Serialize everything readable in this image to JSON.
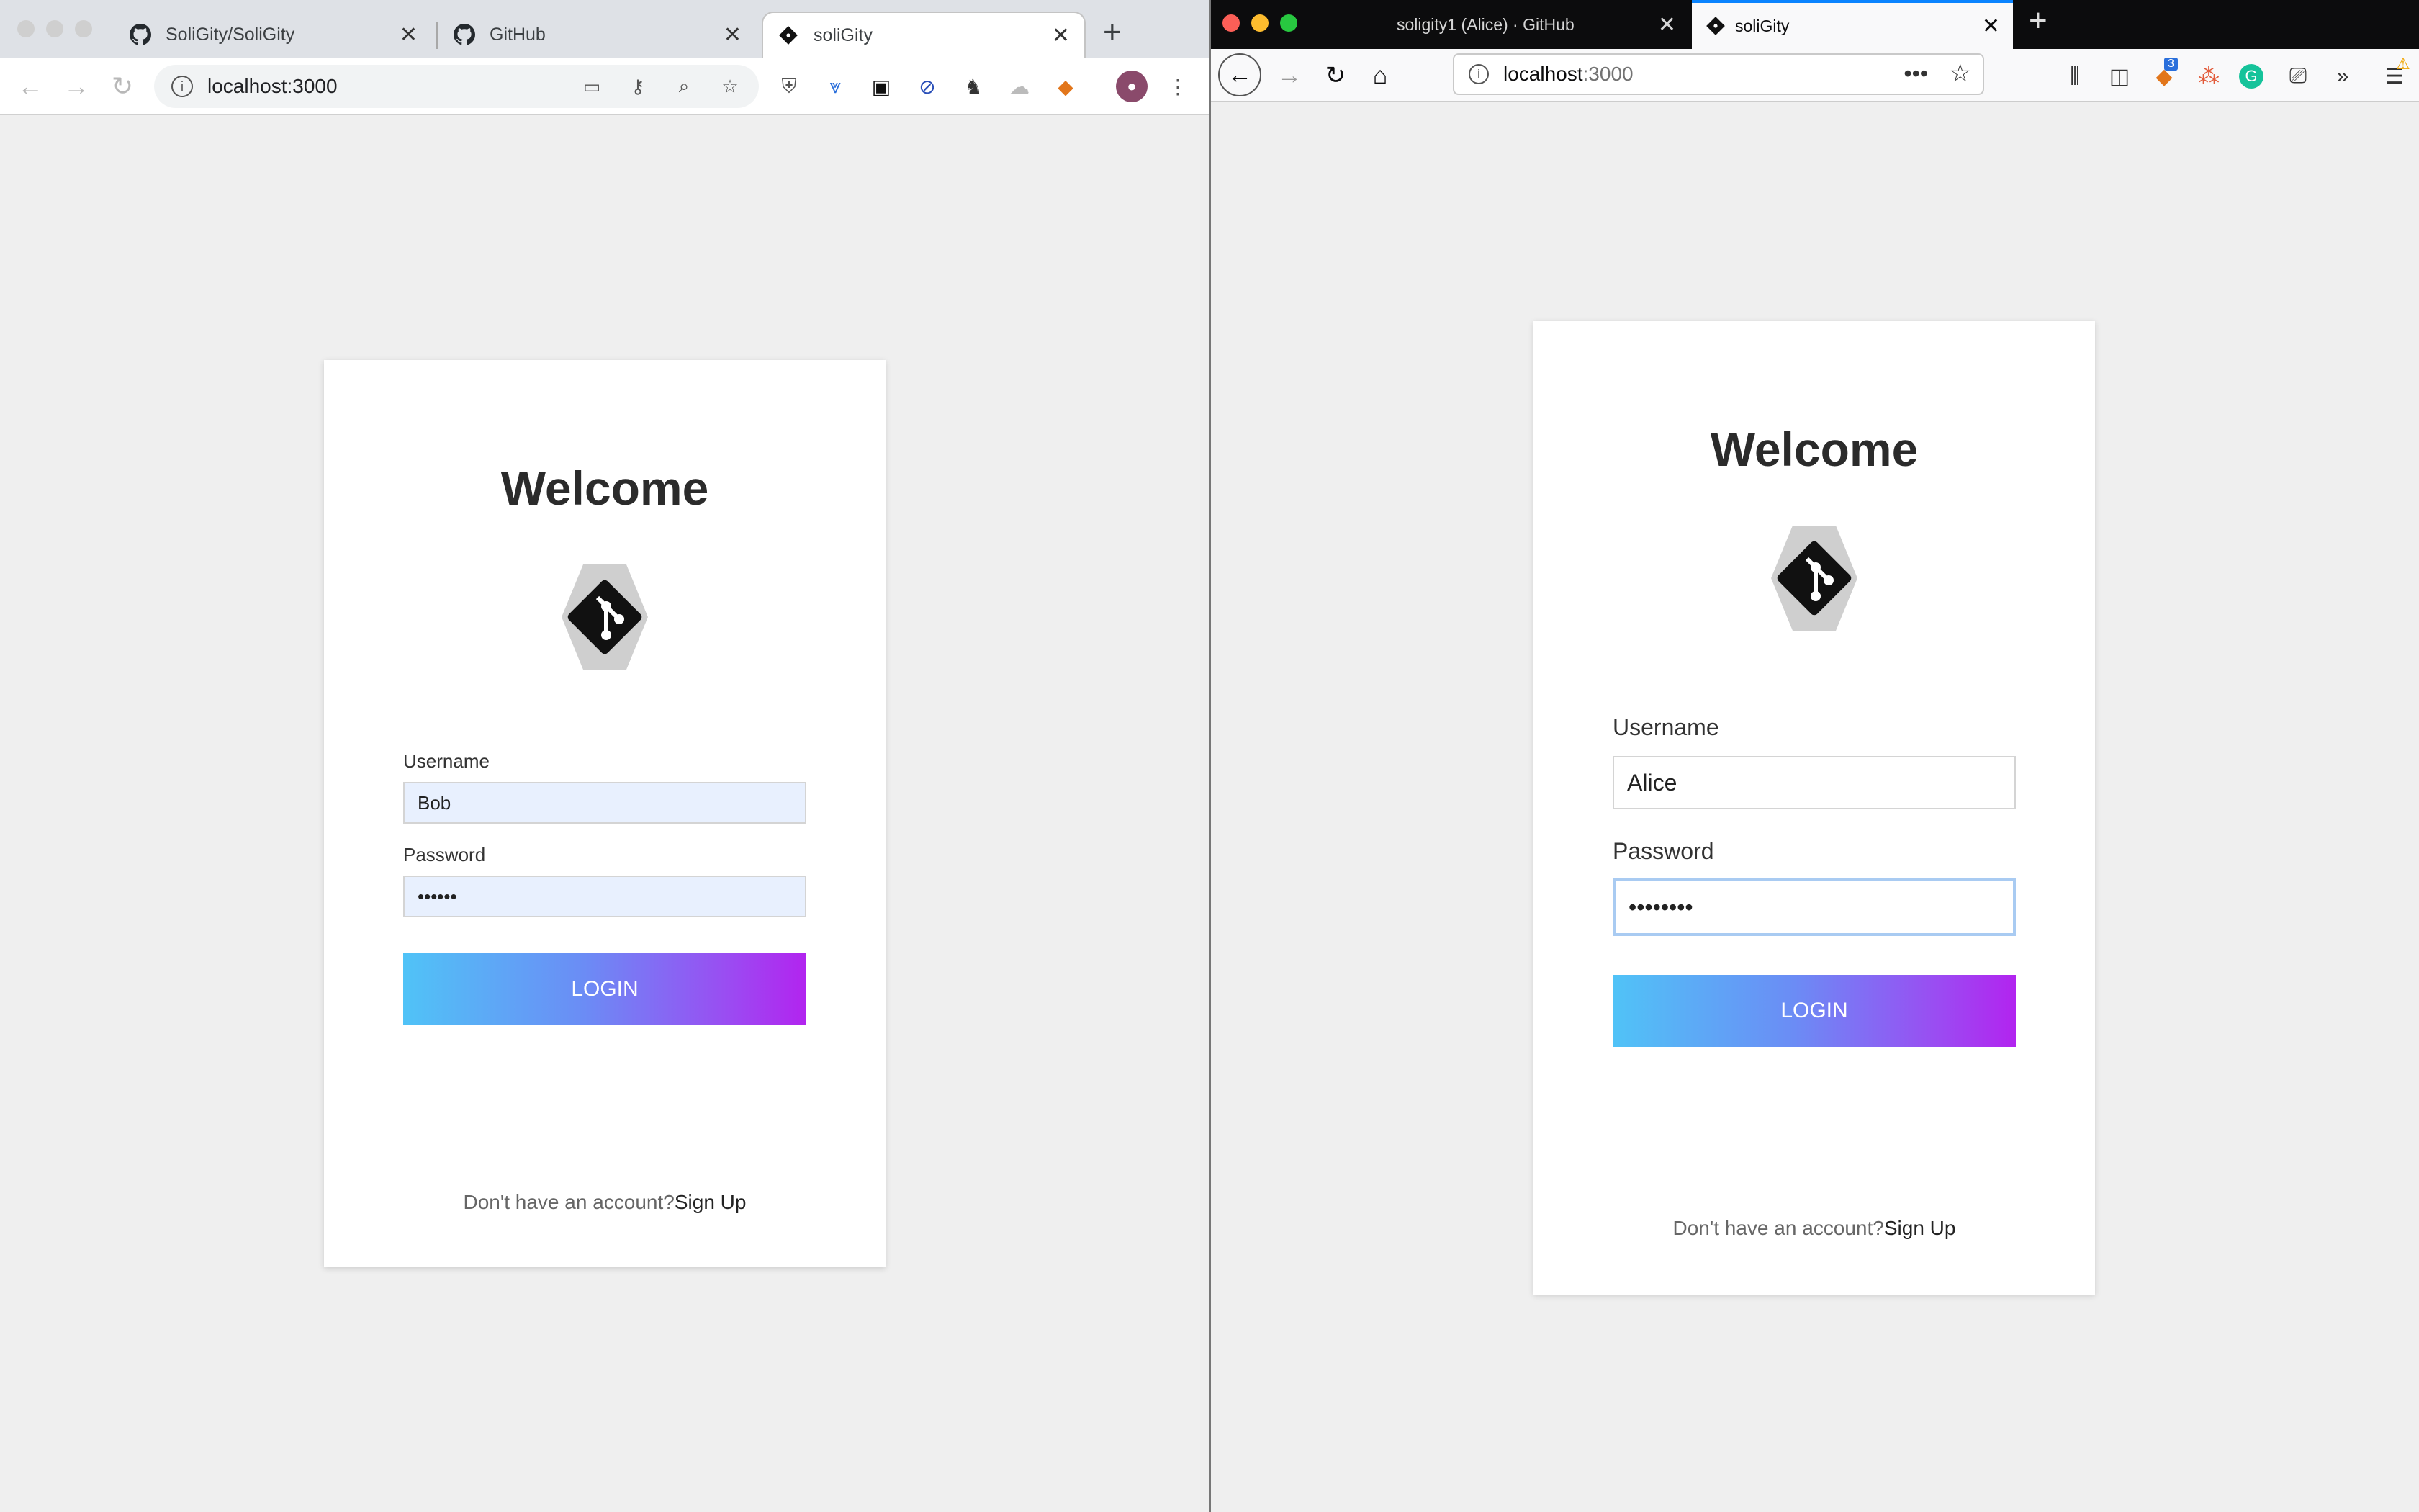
{
  "chrome": {
    "tabs": [
      {
        "title": "SoliGity/SoliGity"
      },
      {
        "title": "GitHub"
      },
      {
        "title": "soliGity"
      }
    ],
    "url": "localhost:3000",
    "login": {
      "title": "Welcome",
      "username_label": "Username",
      "username_value": "Bob",
      "password_label": "Password",
      "password_value": "••••••",
      "button": "LOGIN",
      "footer_text": "Don't have an account?",
      "signup_link": "Sign Up"
    }
  },
  "firefox": {
    "tabs": [
      {
        "title": "soligity1 (Alice) · GitHub"
      },
      {
        "title": "soliGity"
      }
    ],
    "url_host": "localhost",
    "url_port": ":3000",
    "notification_badge": "3",
    "login": {
      "title": "Welcome",
      "username_label": "Username",
      "username_value": "Alice",
      "password_label": "Password",
      "password_value": "••••••••",
      "button": "LOGIN",
      "footer_text": "Don't have an account?",
      "signup_link": "Sign Up"
    }
  },
  "colors": {
    "button_gradient_start": "#50c3f7",
    "button_gradient_end": "#b224ef",
    "autofill_bg": "#e8f0fe",
    "focus_outline": "#a9cbf2"
  }
}
